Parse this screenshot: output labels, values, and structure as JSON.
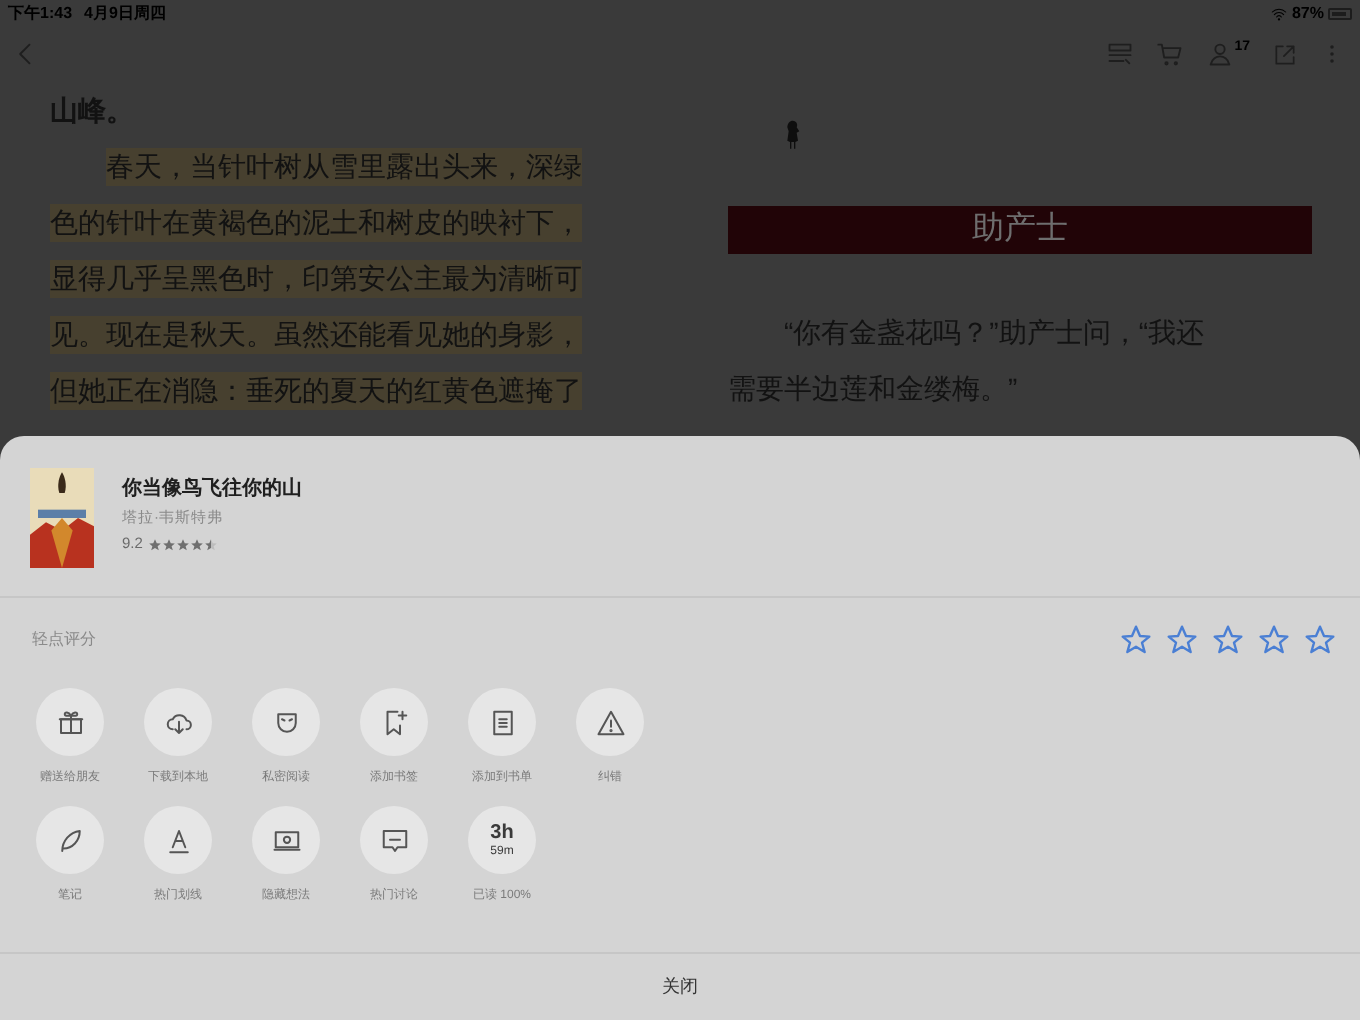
{
  "status_bar": {
    "time": "下午1:43",
    "date": "4月9日周四",
    "battery": "87%"
  },
  "toolbar": {
    "badge": "17"
  },
  "page_left": {
    "lines": [
      {
        "text": "山峰。",
        "highlighted": false,
        "indent": false,
        "bold": true
      },
      {
        "text": "春天，当针叶树从雪里露出头来，深绿",
        "highlighted": true,
        "indent": true,
        "bold": false
      },
      {
        "text": "色的针叶在黄褐色的泥土和树皮的映衬下，",
        "highlighted": true,
        "indent": false,
        "bold": false
      },
      {
        "text": "显得几乎呈黑色时，印第安公主最为清晰可",
        "highlighted": true,
        "indent": false,
        "bold": false
      },
      {
        "text": "见。现在是秋天。虽然还能看见她的身影，",
        "highlighted": true,
        "indent": false,
        "bold": false
      },
      {
        "text": "但她正在消隐：垂死的夏天的红黄色遮掩了",
        "highlighted": true,
        "indent": false,
        "bold": false
      }
    ]
  },
  "page_right": {
    "chapter_title": "助产士",
    "lines": [
      "“你有金盏花吗？”助产士问，“我还",
      "需要半边莲和金缕梅。”"
    ]
  },
  "sheet": {
    "book": {
      "title": "你当像鸟飞往你的山",
      "author": "塔拉·韦斯特弗",
      "score": "9.2",
      "stars": 4.5
    },
    "rate_label": "轻点评分",
    "rating": {
      "stars": 0
    },
    "actions": [
      {
        "kind": "gift",
        "label": "赠送给朋友"
      },
      {
        "kind": "cloud",
        "label": "下载到本地"
      },
      {
        "kind": "mask",
        "label": "私密阅读"
      },
      {
        "kind": "bookmark",
        "label": "添加书签"
      },
      {
        "kind": "list",
        "label": "添加到书单"
      },
      {
        "kind": "warning",
        "label": "纠错"
      },
      {
        "kind": "feather",
        "label": "笔记"
      },
      {
        "kind": "underline",
        "label": "热门划线"
      },
      {
        "kind": "screen",
        "label": "隐藏想法"
      },
      {
        "kind": "chat",
        "label": "热门讨论"
      },
      {
        "kind": "time",
        "hours": "3h",
        "minutes": "59m",
        "label": "已读 100%"
      }
    ],
    "close": "关闭"
  }
}
